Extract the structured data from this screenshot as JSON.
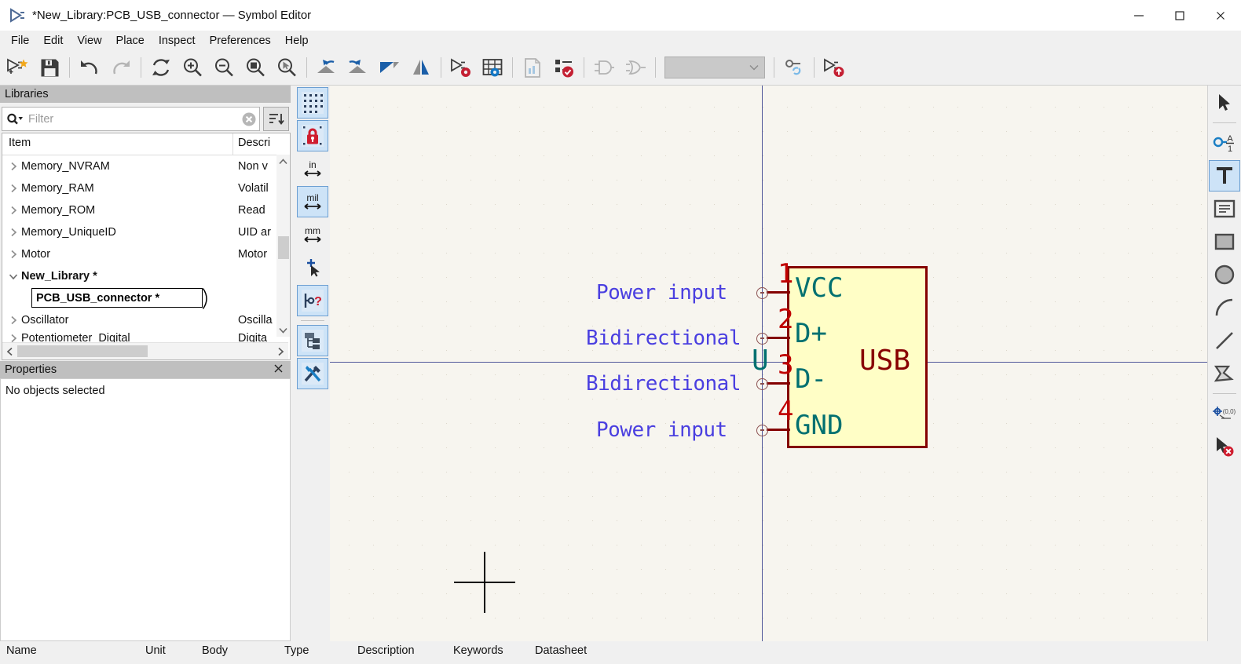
{
  "window": {
    "title": "*New_Library:PCB_USB_connector — Symbol Editor",
    "app_icon": "kicad-symbol-editor-icon",
    "controls": {
      "minimize": "minimize-icon",
      "maximize": "maximize-icon",
      "close": "close-icon"
    }
  },
  "menubar": {
    "items": [
      {
        "label": "File"
      },
      {
        "label": "Edit"
      },
      {
        "label": "View"
      },
      {
        "label": "Place"
      },
      {
        "label": "Inspect"
      },
      {
        "label": "Preferences"
      },
      {
        "label": "Help"
      }
    ]
  },
  "toolbar": {
    "items": [
      {
        "name": "new-symbol-button",
        "icon": "new-symbol-icon",
        "enabled": true
      },
      {
        "name": "save-button",
        "icon": "floppy-save-icon",
        "enabled": true
      },
      {
        "name": "undo-button",
        "icon": "undo-arrow-icon",
        "enabled": true
      },
      {
        "name": "redo-button",
        "icon": "redo-arrow-icon",
        "enabled": false
      },
      {
        "name": "refresh-button",
        "icon": "refresh-icon",
        "enabled": true
      },
      {
        "name": "zoom-in-button",
        "icon": "zoom-in-icon",
        "enabled": true
      },
      {
        "name": "zoom-out-button",
        "icon": "zoom-out-icon",
        "enabled": true
      },
      {
        "name": "zoom-fit-button",
        "icon": "zoom-fit-page-icon",
        "enabled": true
      },
      {
        "name": "zoom-selection-button",
        "icon": "zoom-area-cursor-icon",
        "enabled": true
      },
      {
        "name": "rotate-ccw-button",
        "icon": "rotate-counterclockwise-icon",
        "enabled": true
      },
      {
        "name": "rotate-cw-button",
        "icon": "rotate-clockwise-icon",
        "enabled": true
      },
      {
        "name": "mirror-horizontal-button",
        "icon": "mirror-horizontal-icon",
        "enabled": true
      },
      {
        "name": "mirror-vertical-button",
        "icon": "mirror-vertical-icon",
        "enabled": true
      },
      {
        "name": "symbol-properties-button",
        "icon": "symbol-gear-icon",
        "enabled": true
      },
      {
        "name": "pin-table-button",
        "icon": "pin-table-grid-icon",
        "enabled": true
      },
      {
        "name": "datasheet-button",
        "icon": "datasheet-document-icon",
        "enabled": false
      },
      {
        "name": "check-symbol-button",
        "icon": "erc-checklist-icon",
        "enabled": true
      },
      {
        "name": "deMorgan-standard-button",
        "icon": "demorgan-normal-icon",
        "enabled": false
      },
      {
        "name": "deMorgan-alternate-button",
        "icon": "demorgan-alternate-icon",
        "enabled": false
      },
      {
        "name": "unit-selector",
        "icon": "chevron-down-icon",
        "enabled": false
      },
      {
        "name": "pin-sync-button",
        "icon": "pin-sync-link-icon",
        "enabled": true
      },
      {
        "name": "export-symbol-button",
        "icon": "symbol-export-icon",
        "enabled": true
      }
    ],
    "unit_selector_value": ""
  },
  "libraries_panel": {
    "title": "Libraries",
    "filter": {
      "placeholder": "Filter",
      "value": "",
      "search_icon": "magnifier-dropdown-icon",
      "clear_icon": "clear-circle-icon"
    },
    "sort_button_icon": "sort-descending-icon",
    "columns": [
      "Item",
      "Descri"
    ],
    "rows": [
      {
        "label": "Memory_NVRAM",
        "description": "Non v",
        "expanded": false,
        "bold": false
      },
      {
        "label": "Memory_RAM",
        "description": "Volatil",
        "expanded": false,
        "bold": false
      },
      {
        "label": "Memory_ROM",
        "description": "Read ",
        "expanded": false,
        "bold": false
      },
      {
        "label": "Memory_UniqueID",
        "description": "UID ar",
        "expanded": false,
        "bold": false
      },
      {
        "label": "Motor",
        "description": "Motor",
        "expanded": false,
        "bold": false
      },
      {
        "label": "New_Library *",
        "description": "",
        "expanded": true,
        "bold": true
      },
      {
        "label": "Oscillator",
        "description": "Oscilla",
        "expanded": false,
        "bold": false
      },
      {
        "label": "Potentiometer_Digital",
        "description": "Digita",
        "expanded": false,
        "bold": false
      }
    ],
    "selected_item": "PCB_USB_connector *"
  },
  "properties_panel": {
    "title": "Properties",
    "close_icon": "close-icon",
    "empty_text": "No objects selected"
  },
  "left_toolbar": {
    "items": [
      {
        "name": "toggle-grid-button",
        "icon": "grid-dots-icon",
        "active": true
      },
      {
        "name": "grid-lock-button",
        "icon": "grid-lock-red-icon",
        "active": true
      },
      {
        "name": "units-inches-button",
        "icon": "inches-unit-icon",
        "label": "in",
        "active": false
      },
      {
        "name": "units-mils-button",
        "icon": "mils-unit-icon",
        "label": "mil",
        "active": true
      },
      {
        "name": "units-millimeters-button",
        "icon": "millimeters-unit-icon",
        "label": "mm",
        "active": false
      },
      {
        "name": "toggle-cursor-button",
        "icon": "full-crosshair-cursor-icon",
        "active": false
      },
      {
        "name": "show-pin-electrical-types-button",
        "icon": "pin-electrical-type-icon",
        "active": true
      },
      {
        "name": "show-hierarchy-tree-button",
        "icon": "hierarchy-tree-icon",
        "active": true
      },
      {
        "name": "show-libraries-button",
        "icon": "tools-wrench-screwdriver-icon",
        "active": true
      }
    ]
  },
  "right_toolbar": {
    "items": [
      {
        "name": "select-tool",
        "icon": "arrow-cursor-icon",
        "active": false
      },
      {
        "name": "add-pin-tool",
        "icon": "add-pin-icon",
        "active": false
      },
      {
        "name": "add-text-tool",
        "icon": "text-T-icon",
        "active": true
      },
      {
        "name": "add-textbox-tool",
        "icon": "textbox-icon",
        "active": false
      },
      {
        "name": "add-rectangle-tool",
        "icon": "rectangle-icon",
        "active": false
      },
      {
        "name": "add-circle-tool",
        "icon": "circle-icon",
        "active": false
      },
      {
        "name": "add-arc-tool",
        "icon": "arc-icon",
        "active": false
      },
      {
        "name": "add-line-tool",
        "icon": "line-icon",
        "active": false
      },
      {
        "name": "add-polygon-tool",
        "icon": "polygon-icon",
        "active": false
      },
      {
        "name": "set-anchor-tool",
        "icon": "anchor-origin-icon",
        "active": false
      },
      {
        "name": "delete-tool",
        "icon": "cursor-delete-icon",
        "active": false
      }
    ]
  },
  "canvas": {
    "symbol": {
      "reference": "U",
      "value": "USB",
      "body_fill": "#fffec6",
      "body_stroke": "#840000",
      "pin_name_color": "#007070",
      "pin_number_color": "#c00000",
      "electrical_type_color": "#4a3fe0",
      "pins": [
        {
          "number": "1",
          "name": "VCC",
          "electrical_type": "Power input"
        },
        {
          "number": "2",
          "name": "D+",
          "electrical_type": "Bidirectional"
        },
        {
          "number": "3",
          "name": "D-",
          "electrical_type": "Bidirectional"
        },
        {
          "number": "4",
          "name": "GND",
          "electrical_type": "Power input"
        }
      ]
    }
  },
  "bottom_bar": {
    "columns": [
      "Name",
      "Unit",
      "Body",
      "Type",
      "Description",
      "Keywords",
      "Datasheet"
    ]
  }
}
